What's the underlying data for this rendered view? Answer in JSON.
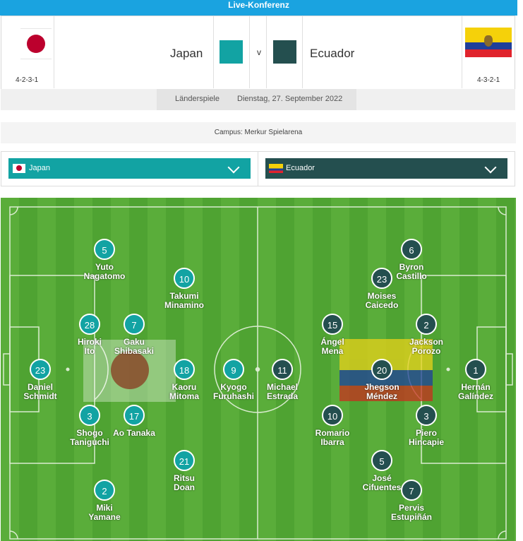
{
  "header": {
    "title": "Live-Konferenz"
  },
  "match": {
    "home": {
      "name": "Japan",
      "formation": "4-2-3-1",
      "color": "#12a3a3"
    },
    "away": {
      "name": "Ecuador",
      "formation": "4-3-2-1",
      "color": "#244f4f"
    },
    "versus": "v",
    "competition": "Länderspiele",
    "date": "Dienstag, 27. September 2022",
    "venue": "Campus: Merkur Spielarena"
  },
  "selectors": {
    "home_label": "Japan",
    "away_label": "Ecuador"
  },
  "lineup": {
    "home": [
      {
        "number": "5",
        "first": "Yuto",
        "last": "Nagatomo"
      },
      {
        "number": "10",
        "first": "Takumi",
        "last": "Minamino"
      },
      {
        "number": "28",
        "first": "Hiroki",
        "last": "Ito"
      },
      {
        "number": "7",
        "first": "Gaku",
        "last": "Shibasaki"
      },
      {
        "number": "23",
        "first": "Daniel",
        "last": "Schmidt"
      },
      {
        "number": "18",
        "first": "Kaoru",
        "last": "Mitoma"
      },
      {
        "number": "9",
        "first": "Kyogo",
        "last": "Furuhashi"
      },
      {
        "number": "3",
        "first": "Shogo",
        "last": "Taniguchi"
      },
      {
        "number": "17",
        "first": "Ao Tanaka",
        "last": ""
      },
      {
        "number": "21",
        "first": "Ritsu",
        "last": "Doan"
      },
      {
        "number": "2",
        "first": "Miki",
        "last": "Yamane"
      }
    ],
    "away": [
      {
        "number": "6",
        "first": "Byron",
        "last": "Castillo"
      },
      {
        "number": "23",
        "first": "Moises",
        "last": "Caicedo"
      },
      {
        "number": "15",
        "first": "Ángel",
        "last": "Mena"
      },
      {
        "number": "2",
        "first": "Jackson",
        "last": "Porozo"
      },
      {
        "number": "11",
        "first": "Michael",
        "last": "Estrada"
      },
      {
        "number": "20",
        "first": "Jhegson",
        "last": "Méndez"
      },
      {
        "number": "1",
        "first": "Hernán",
        "last": "Galíndez"
      },
      {
        "number": "10",
        "first": "Romario",
        "last": "Ibarra"
      },
      {
        "number": "3",
        "first": "Piero",
        "last": "Hincapie"
      },
      {
        "number": "5",
        "first": "José",
        "last": "Cifuentes"
      },
      {
        "number": "7",
        "first": "Pervis",
        "last": "Estupiñán"
      }
    ]
  }
}
